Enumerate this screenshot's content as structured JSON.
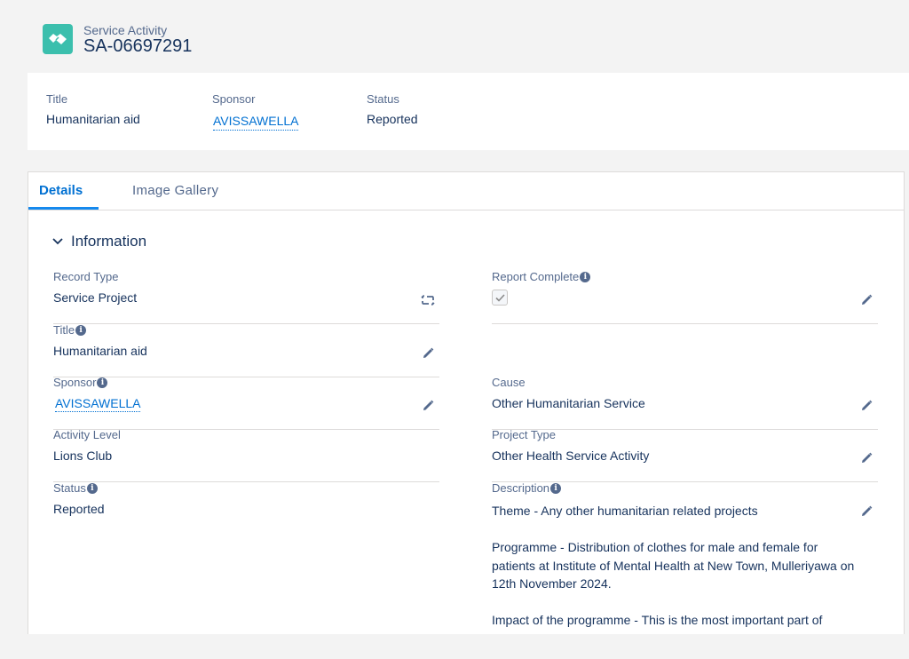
{
  "header": {
    "object_type": "Service Activity",
    "record_name": "SA-06697291"
  },
  "highlights": {
    "title_label": "Title",
    "title_value": "Humanitarian aid",
    "sponsor_label": "Sponsor",
    "sponsor_value": "AVISSAWELLA",
    "status_label": "Status",
    "status_value": "Reported"
  },
  "tabs": {
    "details": "Details",
    "image_gallery": "Image Gallery"
  },
  "section": {
    "title": "Information"
  },
  "fields": {
    "record_type": {
      "label": "Record Type",
      "value": "Service Project"
    },
    "title": {
      "label": "Title",
      "value": "Humanitarian aid"
    },
    "sponsor": {
      "label": "Sponsor",
      "value": "AVISSAWELLA"
    },
    "activity_level": {
      "label": "Activity Level",
      "value": "Lions Club"
    },
    "status": {
      "label": "Status",
      "value": "Reported"
    },
    "report_complete": {
      "label": "Report Complete",
      "checked": true
    },
    "cause": {
      "label": "Cause",
      "value": "Other Humanitarian Service"
    },
    "project_type": {
      "label": "Project Type",
      "value": "Other Health Service Activity"
    },
    "description": {
      "label": "Description",
      "para1": "Theme - Any other humanitarian related projects",
      "para2": "Programme - Distribution of clothes for male and female for patients at Institute of Mental Health at New Town, Mulleriyawa on 12th November 2024.",
      "para3": "Impact of the programme - This is the most important part of"
    }
  },
  "colors": {
    "object_icon": "#3bbfad",
    "link": "#0070d2",
    "tab_active_bar": "#1589ee"
  }
}
